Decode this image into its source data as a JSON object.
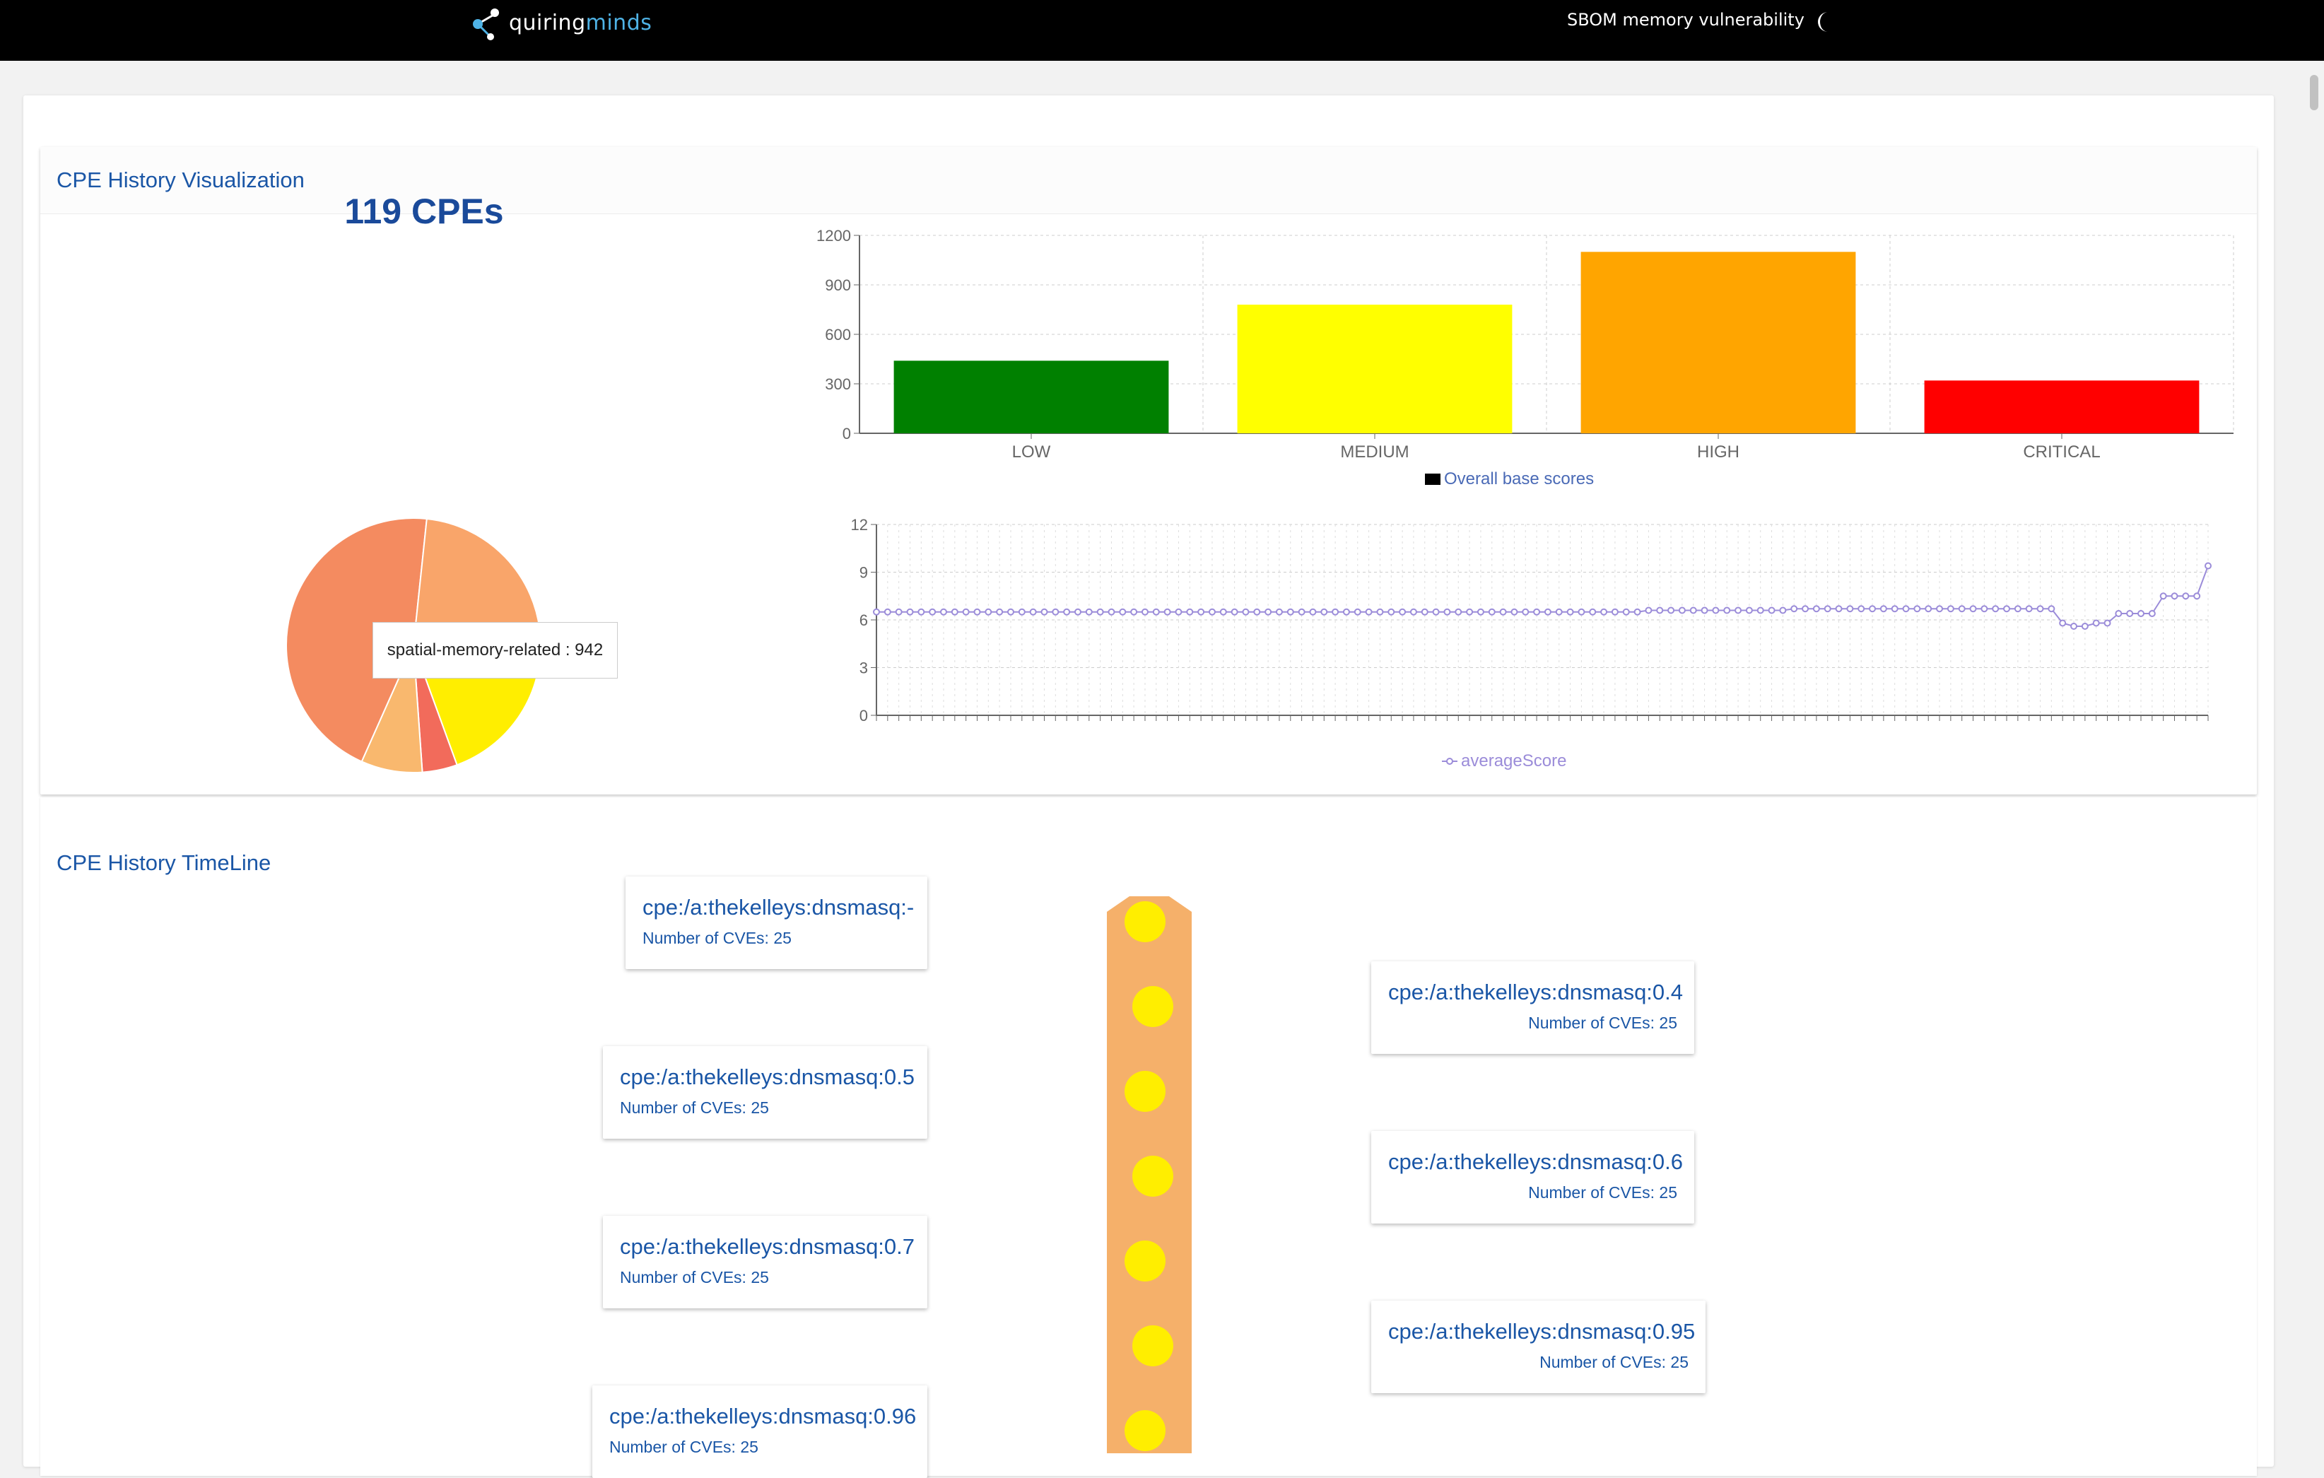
{
  "header": {
    "brand_prefix": "n",
    "brand_quiring": "quiring",
    "brand_minds": "minds",
    "app_title": "SBOM memory vulnerability",
    "theme_icon": "moon-icon"
  },
  "visualization": {
    "title": "CPE History Visualization",
    "cpe_count": "119 CPEs",
    "pie_tooltip": "spatial-memory-related : 942",
    "pie_colors": [
      "#f48b60",
      "#f9a56a",
      "#ffee00",
      "#f26b5b",
      "#f9b86e"
    ]
  },
  "chart_data": [
    {
      "type": "bar",
      "categories": [
        "LOW",
        "MEDIUM",
        "HIGH",
        "CRITICAL"
      ],
      "values": [
        440,
        780,
        1100,
        320
      ],
      "colors": [
        "#008000",
        "#ffff00",
        "#ffa500",
        "#ff0000"
      ],
      "legend": "Overall base scores",
      "ylim": [
        0,
        1200
      ],
      "yticks": [
        "0",
        "300",
        "600",
        "900",
        "1200"
      ],
      "grid": true,
      "legend_position": "bottom"
    },
    {
      "type": "line",
      "series": [
        {
          "name": "averageScore",
          "values": [
            6.5,
            6.5,
            6.5,
            6.5,
            6.5,
            6.5,
            6.5,
            6.5,
            6.5,
            6.5,
            6.5,
            6.5,
            6.5,
            6.5,
            6.5,
            6.5,
            6.5,
            6.5,
            6.5,
            6.5,
            6.5,
            6.5,
            6.5,
            6.5,
            6.5,
            6.5,
            6.5,
            6.5,
            6.5,
            6.5,
            6.5,
            6.5,
            6.5,
            6.5,
            6.5,
            6.5,
            6.5,
            6.5,
            6.5,
            6.5,
            6.5,
            6.5,
            6.5,
            6.5,
            6.5,
            6.5,
            6.5,
            6.5,
            6.5,
            6.5,
            6.5,
            6.5,
            6.5,
            6.5,
            6.5,
            6.5,
            6.5,
            6.5,
            6.5,
            6.5,
            6.5,
            6.5,
            6.5,
            6.5,
            6.5,
            6.5,
            6.5,
            6.5,
            6.5,
            6.6,
            6.6,
            6.6,
            6.6,
            6.6,
            6.6,
            6.6,
            6.6,
            6.6,
            6.6,
            6.6,
            6.6,
            6.6,
            6.7,
            6.7,
            6.7,
            6.7,
            6.7,
            6.7,
            6.7,
            6.7,
            6.7,
            6.7,
            6.7,
            6.7,
            6.7,
            6.7,
            6.7,
            6.7,
            6.7,
            6.7,
            6.7,
            6.7,
            6.7,
            6.7,
            6.7,
            6.7,
            5.8,
            5.6,
            5.6,
            5.8,
            5.8,
            6.4,
            6.4,
            6.4,
            6.4,
            7.5,
            7.5,
            7.5,
            7.5,
            9.4
          ]
        }
      ],
      "ylim": [
        0,
        12
      ],
      "yticks": [
        "0",
        "3",
        "6",
        "9",
        "12"
      ],
      "grid": true,
      "legend_position": "bottom"
    }
  ],
  "timeline": {
    "title": "CPE History TimeLine",
    "items": [
      {
        "title": "cpe:/a:thekelleys:dnsmasq:-",
        "sub": "Number of CVEs: 25"
      },
      {
        "title": "cpe:/a:thekelleys:dnsmasq:0.4",
        "sub": "Number of CVEs: 25"
      },
      {
        "title": "cpe:/a:thekelleys:dnsmasq:0.5",
        "sub": "Number of CVEs: 25"
      },
      {
        "title": "cpe:/a:thekelleys:dnsmasq:0.6",
        "sub": "Number of CVEs: 25"
      },
      {
        "title": "cpe:/a:thekelleys:dnsmasq:0.7",
        "sub": "Number of CVEs: 25"
      },
      {
        "title": "cpe:/a:thekelleys:dnsmasq:0.95",
        "sub": "Number of CVEs: 25"
      },
      {
        "title": "cpe:/a:thekelleys:dnsmasq:0.96",
        "sub": "Number of CVEs: 25"
      }
    ]
  }
}
